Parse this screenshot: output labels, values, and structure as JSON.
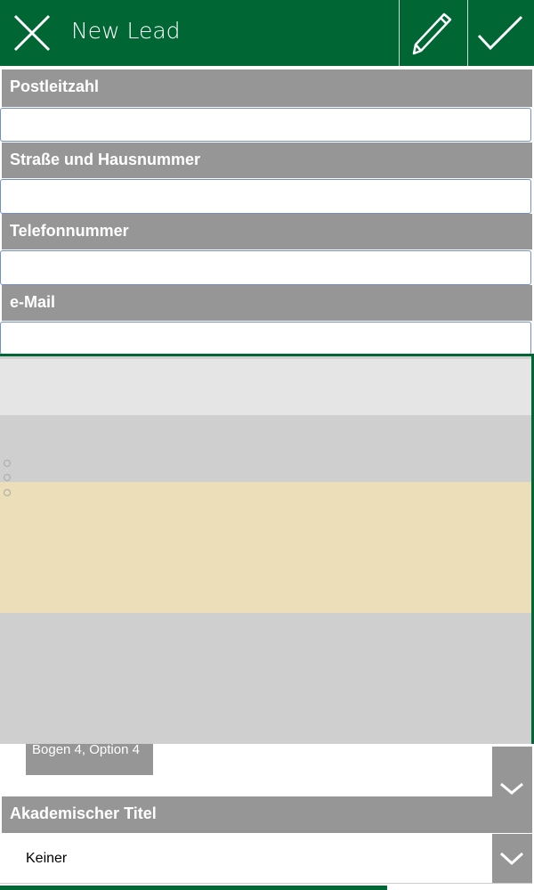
{
  "header": {
    "title": "New Lead",
    "close_icon": "close-icon",
    "edit_icon": "pencil-icon",
    "save_icon": "checkmark-icon",
    "color": "#006633"
  },
  "form": {
    "fields": [
      {
        "label": "Postleitzahl",
        "value": ""
      },
      {
        "label": "Straße und Hausnummer",
        "value": ""
      },
      {
        "label": "Telefonnummer",
        "value": ""
      },
      {
        "label": "e-Mail",
        "value": ""
      }
    ],
    "selected_chip": "Bogen 4, Option 4",
    "academic_title": {
      "label": "Akademischer Titel",
      "value": "Keiner"
    }
  }
}
